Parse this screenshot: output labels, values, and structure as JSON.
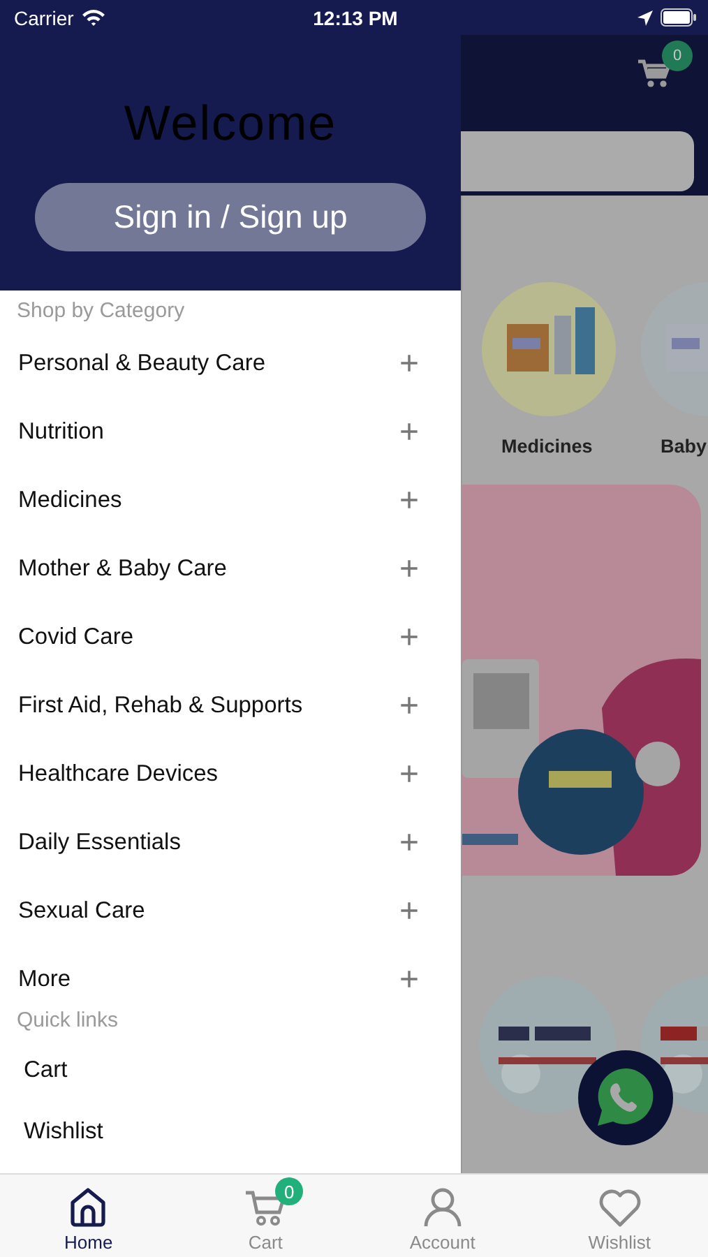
{
  "status_bar": {
    "carrier": "Carrier",
    "time": "12:13 PM"
  },
  "drawer": {
    "title": "Welcome",
    "sign_in_button": "Sign in / Sign up",
    "category_heading": "Shop by Category",
    "categories": [
      {
        "label": "Personal & Beauty Care",
        "expand_icon": "+"
      },
      {
        "label": "Nutrition",
        "expand_icon": "+"
      },
      {
        "label": "Medicines",
        "expand_icon": "+"
      },
      {
        "label": "Mother & Baby Care",
        "expand_icon": "+"
      },
      {
        "label": "Covid Care",
        "expand_icon": "+"
      },
      {
        "label": "First Aid, Rehab & Supports",
        "expand_icon": "+"
      },
      {
        "label": "Healthcare Devices",
        "expand_icon": "+"
      },
      {
        "label": "Daily Essentials",
        "expand_icon": "+"
      },
      {
        "label": "Sexual Care",
        "expand_icon": "+"
      },
      {
        "label": "More",
        "expand_icon": "+"
      }
    ],
    "quick_links_heading": "Quick links",
    "quick_links": [
      "Cart",
      "Wishlist"
    ]
  },
  "background_app": {
    "cart_count": "0",
    "category_tiles": [
      {
        "label": "Medicines",
        "kind": "picture"
      },
      {
        "label": "Baby",
        "kind": "picture"
      }
    ]
  },
  "tab_bar": [
    {
      "label": "Home",
      "kind": "home",
      "selected": true
    },
    {
      "label": "Cart",
      "kind": "cart",
      "selected": false,
      "badge": "0"
    },
    {
      "label": "Account",
      "kind": "account",
      "selected": false
    },
    {
      "label": "Wishlist",
      "kind": "wishlist",
      "selected": false
    }
  ]
}
